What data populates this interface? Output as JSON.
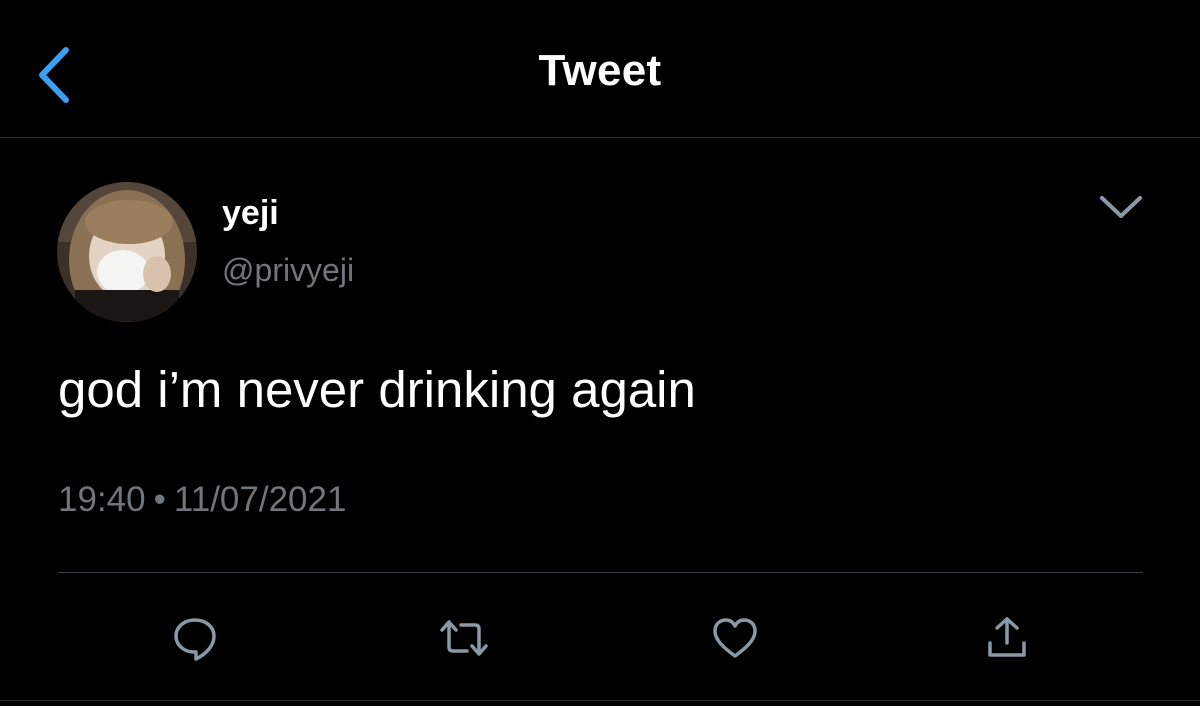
{
  "header": {
    "title": "Tweet",
    "back_icon": "chevron-left-icon"
  },
  "tweet": {
    "author": {
      "display_name": "yeji",
      "handle": "@privyeji"
    },
    "more_icon": "chevron-down-icon",
    "text": "god i’m never drinking again",
    "time": "19:40",
    "separator": "•",
    "date": "11/07/2021"
  },
  "actions": [
    {
      "name": "reply",
      "icon": "comment-icon"
    },
    {
      "name": "retweet",
      "icon": "retweet-icon"
    },
    {
      "name": "like",
      "icon": "heart-icon"
    },
    {
      "name": "share",
      "icon": "share-icon"
    }
  ],
  "colors": {
    "background": "#000000",
    "accent": "#1d9bf0",
    "text_primary": "#ffffff",
    "text_secondary": "#71767b",
    "icon": "#8b98a5"
  }
}
